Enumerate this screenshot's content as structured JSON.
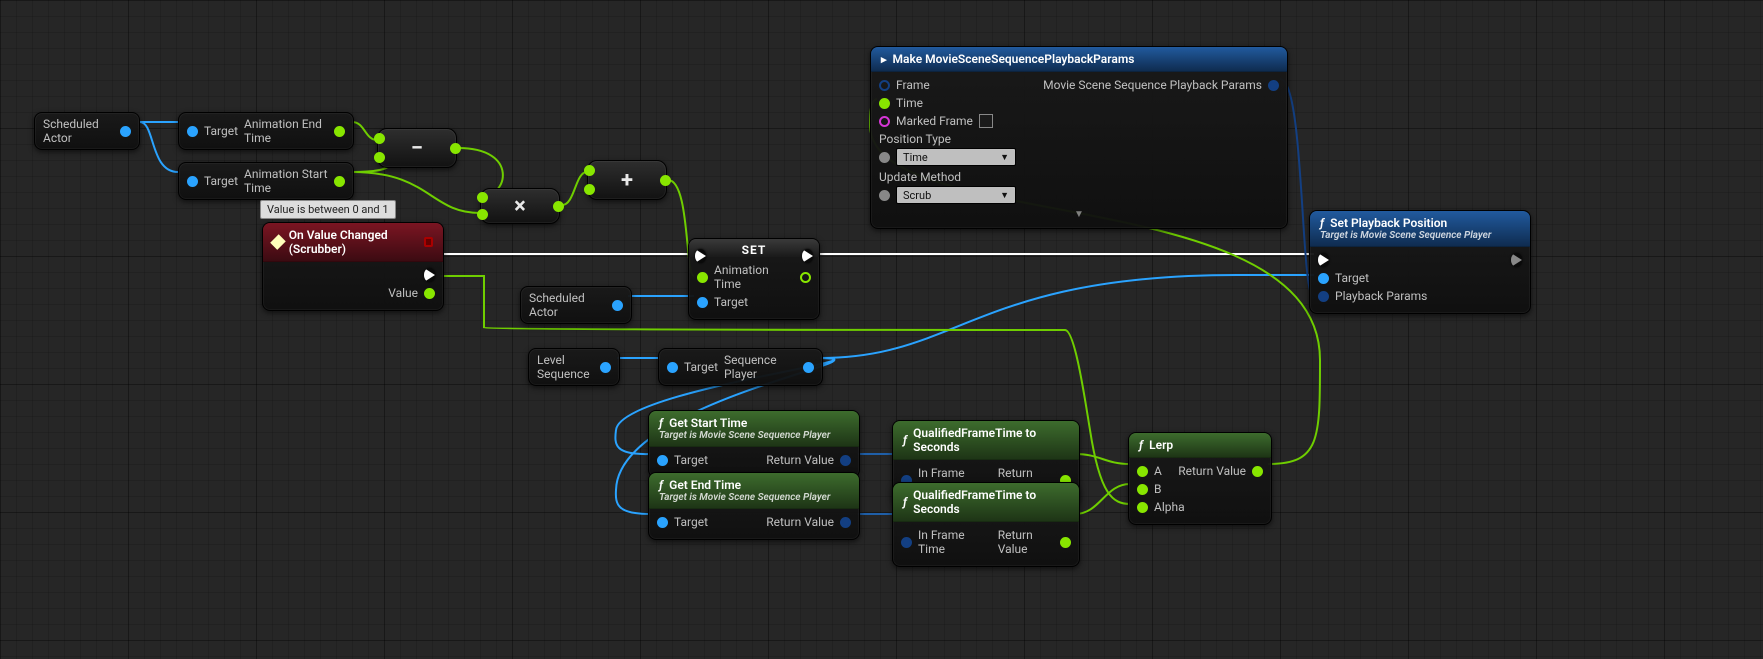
{
  "tooltip": {
    "value_between": "Value is between 0 and 1"
  },
  "vars": {
    "scheduled_actor": "Scheduled Actor",
    "level_sequence": "Level Sequence"
  },
  "pins": {
    "target": "Target",
    "anim_end_time": "Animation End Time",
    "anim_start_time": "Animation Start Time",
    "value": "Value",
    "sequence_player": "Sequence Player",
    "return_value": "Return Value",
    "in_frame_time": "In Frame Time",
    "a": "A",
    "b": "B",
    "alpha": "Alpha",
    "animation_time": "Animation Time",
    "frame": "Frame",
    "time": "Time",
    "marked_frame": "Marked Frame",
    "position_type": "Position Type",
    "update_method": "Update Method",
    "playback_params": "Playback Params",
    "playback_struct": "Movie Scene Sequence Playback Params"
  },
  "ops": {
    "minus": "−",
    "plus": "+",
    "times": "×"
  },
  "event": {
    "title": "On Value Changed (Scrubber)"
  },
  "set": {
    "title": "SET"
  },
  "get_start": {
    "title": "Get Start Time",
    "subtitle": "Target is Movie Scene Sequence Player"
  },
  "get_end": {
    "title": "Get End Time",
    "subtitle": "Target is Movie Scene Sequence Player"
  },
  "qft": {
    "title": "QualifiedFrameTime to Seconds"
  },
  "lerp": {
    "title": "Lerp"
  },
  "sppnode": {
    "title": "Set Playback Position",
    "subtitle": "Target is Movie Scene Sequence Player"
  },
  "make": {
    "title": "Make MovieSceneSequencePlaybackParams",
    "position_type_value": "Time",
    "update_method_value": "Scrub"
  }
}
